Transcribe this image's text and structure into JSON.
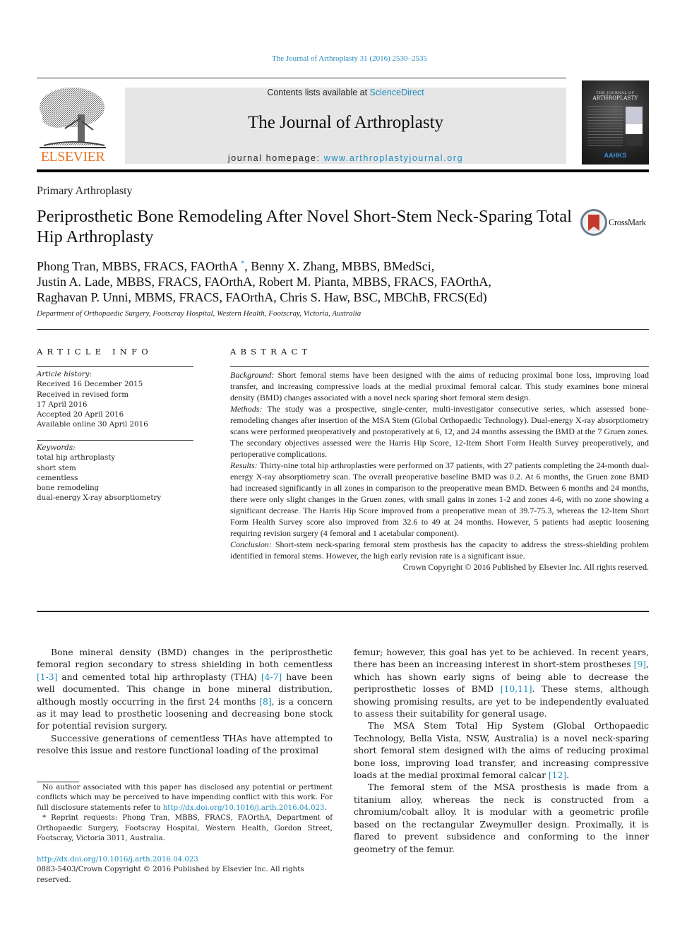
{
  "header": {
    "citation": "The Journal of Arthroplasty 31 (2016) 2530–2535",
    "contents_prefix": "Contents lists available at ",
    "contents_link": "ScienceDirect",
    "journal_name": "The Journal of Arthroplasty",
    "homepage_prefix": "journal homepage: ",
    "homepage_link": "www.arthroplastyjournal.org",
    "publisher_logo": "ELSEVIER",
    "cover": {
      "line1": "THE JOURNAL OF",
      "line2": "ARTHROPLASTY",
      "society": "AAHKS"
    }
  },
  "article": {
    "section": "Primary Arthroplasty",
    "title": "Periprosthetic Bone Remodeling After Novel Short-Stem Neck-Sparing Total Hip Arthroplasty",
    "crossmark_label": "CrossMark",
    "authors": [
      {
        "text": "Phong Tran, MBBS, FRACS, FAOrthA",
        "mark": "*"
      },
      {
        "text": ", Benny X. Zhang, MBBS, BMedSci,"
      },
      {
        "text": "Justin A. Lade, MBBS, FRACS, FAOrthA, Robert M. Pianta, MBBS, FRACS, FAOrthA,"
      },
      {
        "text": "Raghavan P. Unni, MBMS, FRACS, FAOrthA, Chris S. Haw, BSC, MBChB, FRCS(Ed)"
      }
    ],
    "affiliation": "Department of Orthopaedic Surgery, Footscray Hospital, Western Health, Footscray, Victoria, Australia"
  },
  "article_info": {
    "heading": "ARTICLE INFO",
    "history_label": "Article history:",
    "history": [
      "Received 16 December 2015",
      "Received in revised form",
      "17 April 2016",
      "Accepted 20 April 2016",
      "Available online 30 April 2016"
    ],
    "keywords_label": "Keywords:",
    "keywords": [
      "total hip arthroplasty",
      "short stem",
      "cementless",
      "bone remodeling",
      "dual-energy X-ray absorptiometry"
    ]
  },
  "abstract": {
    "heading": "ABSTRACT",
    "sections": [
      {
        "label": "Background:",
        "text": " Short femoral stems have been designed with the aims of reducing proximal bone loss, improving load transfer, and increasing compressive loads at the medial proximal femoral calcar. This study examines bone mineral density (BMD) changes associated with a novel neck sparing short femoral stem design."
      },
      {
        "label": "Methods:",
        "text": " The study was a prospective, single-center, multi-investigator consecutive series, which assessed bone-remodeling changes after insertion of the MSA Stem (Global Orthopaedic Technology). Dual-energy X-ray absorptiometry scans were performed preoperatively and postoperatively at 6, 12, and 24 months assessing the BMD at the 7 Gruen zones. The secondary objectives assessed were the Harris Hip Score, 12-Item Short Form Health Survey preoperatively, and perioperative complications."
      },
      {
        "label": "Results:",
        "text": "  Thirty-nine total hip arthroplasties were performed on 37 patients, with 27 patients completing the 24-month dual-energy X-ray absorptiometry scan. The overall preoperative baseline BMD was 0.2. At 6 months, the Gruen zone BMD had increased significantly in all zones in comparison to the preoperative mean BMD. Between 6 months and 24 months, there were only slight changes in the Gruen zones, with small gains in zones 1-2 and zones 4-6, with no zone showing a significant decrease. The Harris Hip Score improved from a preoperative mean of 39.7-75.3, whereas the 12-Item Short Form Health Survey score also improved from 32.6 to 49 at 24 months. However, 5 patients had aseptic loosening requiring revision surgery (4 femoral and 1 acetabular component)."
      },
      {
        "label": "Conclusion:",
        "text": " Short-stem neck-sparing femoral stem prosthesis has the capacity to address the stress-shielding problem identified in femoral stems. However, the high early revision rate is a significant issue."
      }
    ],
    "copyright": "Crown Copyright © 2016 Published by Elsevier Inc. All rights reserved."
  },
  "body": {
    "left_paragraphs": [
      [
        {
          "t": "Bone mineral density (BMD) changes in the periprosthetic femoral region secondary to stress shielding in both cementless "
        },
        {
          "ref": "[1-3]"
        },
        {
          "t": " and cemented total hip arthroplasty (THA) "
        },
        {
          "ref": "[4-7]"
        },
        {
          "t": " have been well documented. This change in bone mineral distribution, although mostly occurring in the first 24 months "
        },
        {
          "ref": "[8]"
        },
        {
          "t": ", is a concern as it may lead to prosthetic loosening and decreasing bone stock for potential revision surgery."
        }
      ],
      [
        {
          "t": "Successive generations of cementless THAs have attempted to resolve this issue and restore functional loading of the proximal"
        }
      ]
    ],
    "right_paragraphs": [
      [
        {
          "t": "femur; however, this goal has yet to be achieved. In recent years, there has been an increasing interest in short-stem prostheses "
        },
        {
          "ref": "[9]"
        },
        {
          "t": ", which has shown early signs of being able to decrease the periprosthetic losses of BMD "
        },
        {
          "ref": "[10,11]"
        },
        {
          "t": ". These stems, although showing promising results, are yet to be independently evaluated to assess their suitability for general usage."
        }
      ],
      [
        {
          "t": "The MSA Stem Total Hip System (Global Orthopaedic Technology, Bella Vista, NSW, Australia) is a novel neck-sparing short femoral stem designed with the aims of reducing proximal bone loss, improving load transfer, and increasing compressive loads at the medial proximal femoral calcar "
        },
        {
          "ref": "[12]"
        },
        {
          "t": "."
        }
      ],
      [
        {
          "t": "The femoral stem of the MSA prosthesis is made from a titanium alloy, whereas the neck is constructed from a chromium/cobalt alloy. It is modular with a geometric profile based on the rectangular Zweymuller design. Proximally, it is flared to prevent subsidence and conforming to the inner geometry of the femur."
        }
      ]
    ]
  },
  "footnotes": {
    "disclosure_text": "No author associated with this paper has disclosed any potential or pertinent conflicts which may be perceived to have impending conflict with this work. For full disclosure statements refer to ",
    "disclosure_link": "http://dx.doi.org/10.1016/j.arth.2016.04.023",
    "disclosure_end": ".",
    "reprint": "* Reprint requests: Phong Tran, MBBS, FRACS, FAOrthA, Department of Orthopaedic Surgery, Footscray Hospital, Western Health, Gordon Street, Footscray, Victoria 3011, Australia.",
    "doi": "http://dx.doi.org/10.1016/j.arth.2016.04.023",
    "issn_copyright": "0883-5403/Crown Copyright © 2016 Published by Elsevier Inc. All rights reserved."
  },
  "colors": {
    "link": "#1f8bbf",
    "elsevier_orange": "#e9782b",
    "banner_gray": "#e6e6e6"
  }
}
